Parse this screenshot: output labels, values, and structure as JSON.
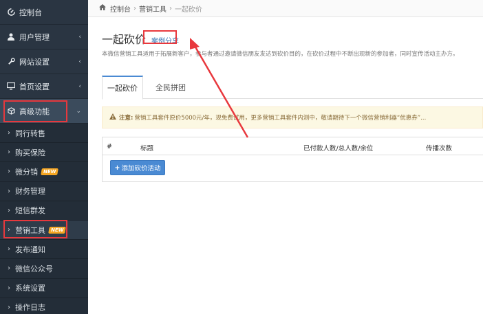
{
  "sidebar": {
    "items": [
      {
        "label": "控制台",
        "icon": "dashboard-icon",
        "has_children": false
      },
      {
        "label": "用户管理",
        "icon": "user-icon",
        "has_children": true
      },
      {
        "label": "网站设置",
        "icon": "wrench-icon",
        "has_children": true
      },
      {
        "label": "首页设置",
        "icon": "monitor-icon",
        "has_children": true
      },
      {
        "label": "高级功能",
        "icon": "cube-icon",
        "has_children": true,
        "expanded": true
      }
    ],
    "sub_items": [
      {
        "label": "同行转售"
      },
      {
        "label": "购买保险"
      },
      {
        "label": "微分销",
        "badge": "NEW"
      },
      {
        "label": "财务管理"
      },
      {
        "label": "短信群发"
      },
      {
        "label": "营销工具",
        "badge": "NEW",
        "current": true
      },
      {
        "label": "发布通知"
      },
      {
        "label": "微信公众号"
      },
      {
        "label": "系统设置"
      },
      {
        "label": "操作日志"
      }
    ]
  },
  "breadcrumb": {
    "items": [
      "控制台",
      "营销工具"
    ],
    "current": "一起砍价"
  },
  "page": {
    "title": "一起砍价",
    "case_link": "案例分享",
    "description": "本微信营销工具适用于拓展新客户，参与者通过邀请微信朋友发达到砍价目的，在砍价过程中不断出现新的参加者，同时宣传活动主办方。"
  },
  "tabs": [
    {
      "label": "一起砍价",
      "active": true
    },
    {
      "label": "全民拼团",
      "active": false
    }
  ],
  "alert": {
    "strong": "注意:",
    "text": "营销工具套件原价5000元/年，现免费试用，更多营销工具套件内测中，敬请期待下一个微信营销利器“优惠券”..."
  },
  "table": {
    "headers": [
      "#",
      "标题",
      "已付款人数/总人数/余位",
      "传播次数"
    ]
  },
  "add_button": "添加砍价活动",
  "colors": {
    "sidebar_bg": "#2a3542",
    "accent": "#4a8ad3",
    "annotation_red": "#e8383d",
    "badge": "#f5a623"
  }
}
